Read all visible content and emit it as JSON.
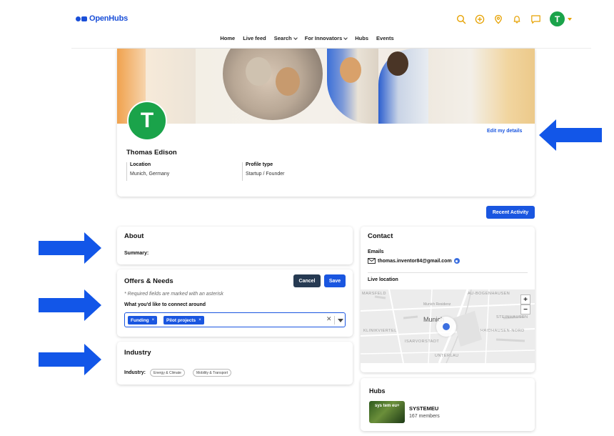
{
  "header": {
    "logo_text": "OpenHubs",
    "avatar_initial": "T",
    "icons": [
      "search-icon",
      "add-icon",
      "location-icon",
      "bell-icon",
      "message-icon"
    ],
    "accent_color": "#e6a100"
  },
  "nav": {
    "items": [
      {
        "label": "Home",
        "has_menu": false
      },
      {
        "label": "Live feed",
        "has_menu": false
      },
      {
        "label": "Search",
        "has_menu": true
      },
      {
        "label": "For Innovators",
        "has_menu": true
      },
      {
        "label": "Hubs",
        "has_menu": false
      },
      {
        "label": "Events",
        "has_menu": false
      }
    ]
  },
  "profile": {
    "avatar_initial": "T",
    "name": "Thomas Edison",
    "edit_label": "Edit my details",
    "location_label": "Location",
    "location_value": "Munich, Germany",
    "profile_type_label": "Profile type",
    "profile_type_value": "Startup / Founder"
  },
  "recent_activity_label": "Recent Activity",
  "about": {
    "title": "About",
    "summary_label": "Summary:"
  },
  "offers": {
    "title": "Offers & Needs",
    "cancel_label": "Cancel",
    "save_label": "Save",
    "required_note": "* Required fields are marked with an asterisk",
    "connect_label": "What you'd like to connect around",
    "chips": [
      "Funding",
      "Pilot projects"
    ]
  },
  "industry": {
    "title": "Industry",
    "label": "Industry:",
    "tags": [
      "Energy & Climate",
      "Mobility & Transport"
    ]
  },
  "contact": {
    "title": "Contact",
    "emails_label": "Emails",
    "email": "thomas.inventor84@gmail.com",
    "live_location_label": "Live location",
    "map": {
      "city": "Munich",
      "labels": [
        "MARSFELD",
        "AU-BOGENHAUSEN",
        "Munich Residenz",
        "STEINHAUSEN",
        "KLINIKVIERTEL",
        "HAIDHAUSEN-NORD",
        "ISARVORSTADT",
        "UNTERLAU"
      ],
      "zoom_in": "+",
      "zoom_out": "−"
    }
  },
  "hubs": {
    "title": "Hubs",
    "items": [
      {
        "name": "SYSTEMEU",
        "members": "167 members",
        "image_text": "sys tem eu+"
      }
    ]
  },
  "colors": {
    "primary": "#1a56e0",
    "dark_button": "#263a52",
    "avatar_green": "#1aa34a",
    "arrow_blue": "#1256e8"
  }
}
